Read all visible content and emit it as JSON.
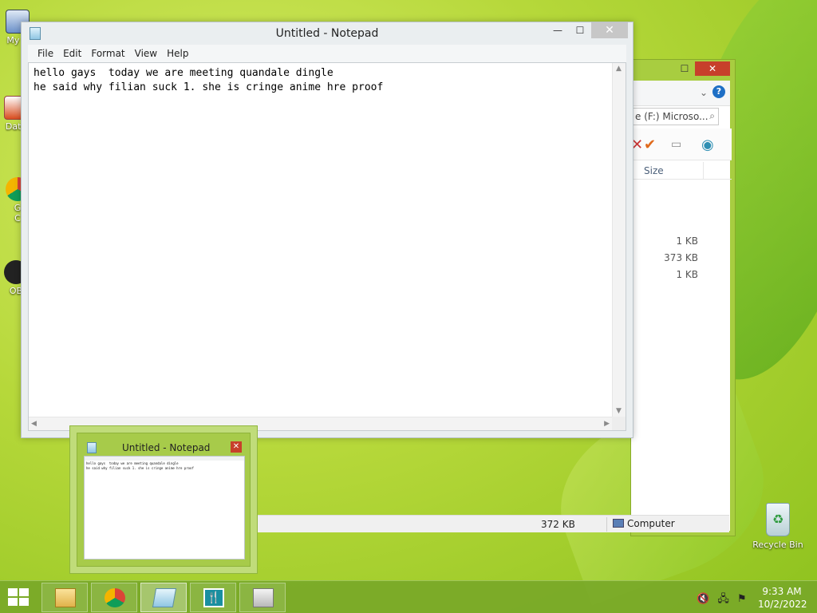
{
  "desktop": {
    "icons": [
      {
        "label": "My C"
      },
      {
        "label": "Data"
      },
      {
        "label": "G\nC"
      },
      {
        "label": "OB"
      }
    ],
    "recycle_bin": {
      "label": "Recycle Bin"
    }
  },
  "explorer": {
    "address_text": "e (F:) Microso...",
    "column_header": "Size",
    "sizes": [
      "1 KB",
      "373 KB",
      "1 KB"
    ],
    "status": {
      "selected_size": "372 KB",
      "location": "Computer"
    }
  },
  "notepad": {
    "title": "Untitled - Notepad",
    "menu": [
      "File",
      "Edit",
      "Format",
      "View",
      "Help"
    ],
    "text_line1": "hello gays  today we are meeting quandale dingle",
    "text_line2": "he said why filian suck 1. she is cringe anime hre proof"
  },
  "thumbnail": {
    "title": "Untitled - Notepad"
  },
  "taskbar": {
    "clock_time": "9:33 AM",
    "clock_date": "10/2/2022"
  }
}
